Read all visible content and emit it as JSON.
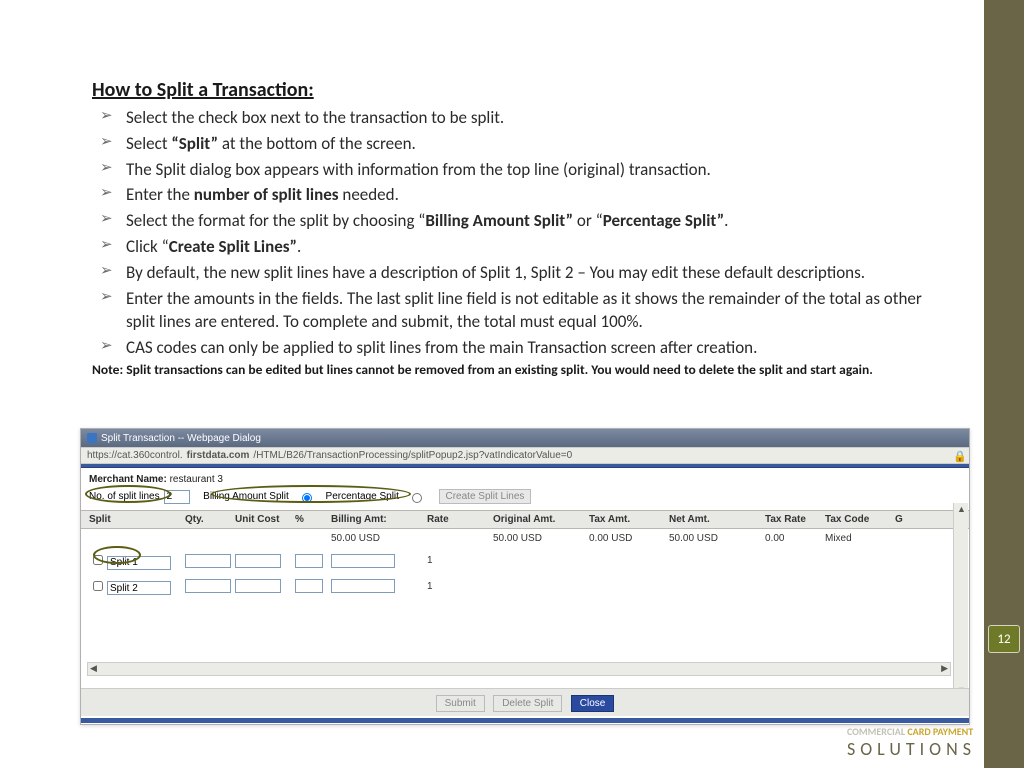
{
  "title": "How to Split a Transaction:",
  "bullets": [
    {
      "pre": "Select the check box next to the transaction to be split."
    },
    {
      "pre": "Select ",
      "bold": "“Split”",
      "post": " at the bottom of the screen."
    },
    {
      "pre": "The Split dialog box appears with information from the top line (original) transaction."
    },
    {
      "pre": "Enter the ",
      "bold": "number of split lines",
      "post": " needed."
    },
    {
      "pre": "Select the format for the split by choosing “",
      "bold": "Billing Amount Split”",
      "post": " or “",
      "bold2": "Percentage Split”",
      "post2": "."
    },
    {
      "pre": "Click “",
      "bold": "Create Split Lines”",
      "post": "."
    },
    {
      "pre": "By default, the new split lines have a description of Split 1, Split 2 – You may edit these default descriptions."
    },
    {
      "pre": "Enter the amounts in the fields. The last split line field is not editable as it shows the remainder of the total as other split lines are entered. To complete and submit, the total must equal 100%."
    },
    {
      "pre": "CAS codes can only be applied to split lines from the main Transaction screen after creation."
    }
  ],
  "note": "Note:  Split transactions can be edited but lines cannot be removed from an existing split.  You would need to delete the split and start again.",
  "page_number": "12",
  "brand": {
    "line1a": "COMMERCIAL",
    "line1b": " CARD PAYMENT",
    "line2": "SOLUTIONS"
  },
  "dialog": {
    "title": "Split Transaction -- Webpage Dialog",
    "url_prefix": "https://cat.360control.",
    "url_bold": "firstdata.com",
    "url_tail": "/HTML/B26/TransactionProcessing/splitPopup2.jsp?vatIndicatorValue=0",
    "merchant_label": "Merchant Name:",
    "merchant_value": "restaurant 3",
    "no_lines_label": "No. of split lines",
    "no_lines_value": "2",
    "radio_billing": "Billing Amount Split",
    "radio_pct": "Percentage Split",
    "create_btn": "Create Split Lines",
    "headers": {
      "split": "Split",
      "qty": "Qty.",
      "unit": "Unit Cost",
      "pct": "%",
      "billing": "Billing Amt:",
      "rate": "Rate",
      "orig": "Original Amt.",
      "tax": "Tax Amt.",
      "net": "Net Amt.",
      "trate": "Tax Rate",
      "tcode": "Tax Code",
      "g": "G"
    },
    "summary": {
      "billing": "50.00 USD",
      "orig": "50.00 USD",
      "tax": "0.00 USD",
      "net": "50.00 USD",
      "trate": "0.00",
      "tcode": "Mixed"
    },
    "rows": [
      {
        "name": "Split 1",
        "rate": "1"
      },
      {
        "name": "Split 2",
        "rate": "1"
      }
    ],
    "buttons": {
      "submit": "Submit",
      "delete": "Delete Split",
      "close": "Close"
    }
  }
}
